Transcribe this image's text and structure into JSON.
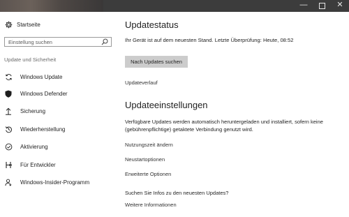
{
  "window": {
    "minimize_glyph": "—",
    "close_glyph": "✕"
  },
  "sidebar": {
    "home_label": "Startseite",
    "home_icon": "gear-icon",
    "search": {
      "placeholder": "Einstellung suchen",
      "icon": "search-icon"
    },
    "section_label": "Update und Sicherheit",
    "items": [
      {
        "label": "Windows Update",
        "icon": "sync-icon",
        "active": true
      },
      {
        "label": "Windows Defender",
        "icon": "shield-icon"
      },
      {
        "label": "Sicherung",
        "icon": "backup-arrow-icon"
      },
      {
        "label": "Wiederherstellung",
        "icon": "recovery-icon"
      },
      {
        "label": "Aktivierung",
        "icon": "check-circle-icon"
      },
      {
        "label": "Für Entwickler",
        "icon": "developer-icon"
      },
      {
        "label": "Windows-Insider-Programm",
        "icon": "insider-person-icon"
      }
    ]
  },
  "main": {
    "status_title": "Updatestatus",
    "status_text": "Ihr Gerät ist auf dem neuesten Stand. Letzte Überprüfung: Heute, 08:52",
    "check_button": "Nach Updates suchen",
    "history_link": "Updateverlauf",
    "settings_title": "Updateeinstellungen",
    "settings_text": "Verfügbare Updates werden automatisch heruntergeladen und installiert, sofern keine (gebührenpflichtige) getaktete Verbindung genutzt wird.",
    "links": [
      "Nutzungszeit ändern",
      "Neustartoptionen",
      "Erweiterte Optionen"
    ],
    "info_question": "Suchen Sie Infos zu den neuesten Updates?",
    "info_link": "Weitere Informationen"
  }
}
